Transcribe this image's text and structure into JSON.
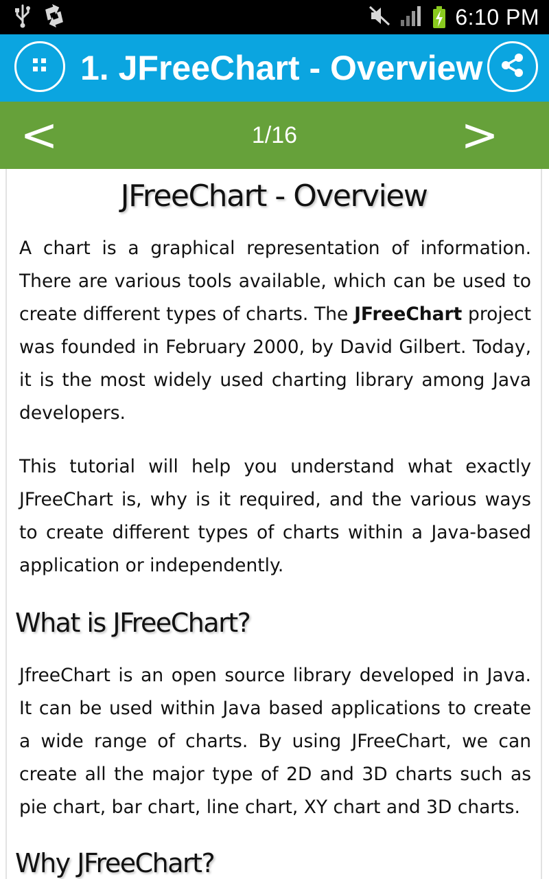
{
  "status_bar": {
    "time": "6:10 PM",
    "icons": [
      "usb-icon",
      "sync-icon",
      "mute-icon",
      "signal-icon",
      "battery-charging-icon"
    ]
  },
  "titlebar": {
    "title": "1. JFreeChart - Overview",
    "menu_icon": "grid-menu-icon",
    "share_icon": "share-icon",
    "accent": "#0ba5e0"
  },
  "navbar": {
    "prev_label": "<",
    "next_label": ">",
    "page_counter": "1/16",
    "accent": "#66a13a"
  },
  "article": {
    "heading": "JFreeChart - Overview",
    "para1_before": "A chart is a graphical representation of information. There are various tools available, which can be used to create different types of charts. The ",
    "para1_bold": "JFreeChart",
    "para1_after": " project was founded in February 2000, by David Gilbert. Today, it is the most widely used charting library among Java developers.",
    "para2": "This tutorial will help you understand what exactly JFreeChart is, why is it required, and the various ways to create different types of charts within a Java-based application or independently.",
    "section1_heading": "What is JFreeChart?",
    "section1_para": "JfreeChart is an open source library developed in Java. It can be used within Java based applications to create a wide range of charts. By using JFreeChart, we can create all the major type of 2D and 3D charts such as pie chart, bar chart, line chart, XY chart and 3D charts.",
    "section2_heading": "Why JFreeChart?"
  }
}
